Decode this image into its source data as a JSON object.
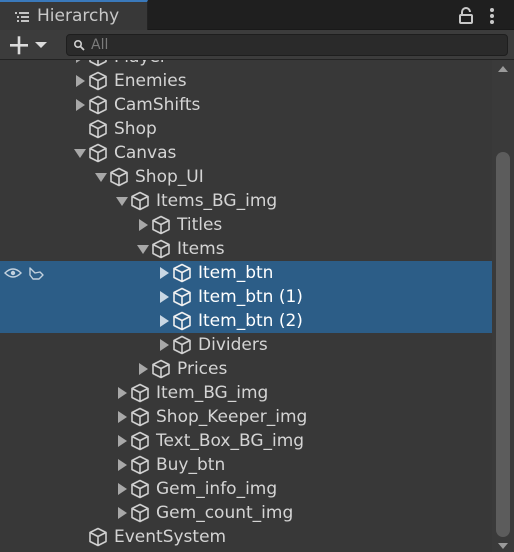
{
  "panel": {
    "title": "Hierarchy",
    "lock_icon": "lock-icon",
    "more_icon": "more-vertical-icon"
  },
  "toolbar": {
    "create_icon": "plus-icon",
    "search_placeholder": "All",
    "search_value": ""
  },
  "tree": {
    "items": [
      {
        "label": "Player",
        "depth": 1,
        "expander": "collapsed",
        "selected": false
      },
      {
        "label": "Enemies",
        "depth": 1,
        "expander": "collapsed",
        "selected": false
      },
      {
        "label": "CamShifts",
        "depth": 1,
        "expander": "collapsed",
        "selected": false
      },
      {
        "label": "Shop",
        "depth": 1,
        "expander": "none",
        "selected": false
      },
      {
        "label": "Canvas",
        "depth": 1,
        "expander": "expanded",
        "selected": false
      },
      {
        "label": "Shop_UI",
        "depth": 2,
        "expander": "expanded",
        "selected": false
      },
      {
        "label": "Items_BG_img",
        "depth": 3,
        "expander": "expanded",
        "selected": false
      },
      {
        "label": "Titles",
        "depth": 4,
        "expander": "collapsed",
        "selected": false
      },
      {
        "label": "Items",
        "depth": 4,
        "expander": "expanded",
        "selected": false
      },
      {
        "label": "Item_btn",
        "depth": 5,
        "expander": "collapsed",
        "selected": true
      },
      {
        "label": "Item_btn (1)",
        "depth": 5,
        "expander": "collapsed",
        "selected": true
      },
      {
        "label": "Item_btn (2)",
        "depth": 5,
        "expander": "collapsed",
        "selected": true
      },
      {
        "label": "Dividers",
        "depth": 5,
        "expander": "collapsed",
        "selected": false
      },
      {
        "label": "Prices",
        "depth": 4,
        "expander": "collapsed",
        "selected": false
      },
      {
        "label": "Item_BG_img",
        "depth": 3,
        "expander": "collapsed",
        "selected": false
      },
      {
        "label": "Shop_Keeper_img",
        "depth": 3,
        "expander": "collapsed",
        "selected": false
      },
      {
        "label": "Text_Box_BG_img",
        "depth": 3,
        "expander": "collapsed",
        "selected": false
      },
      {
        "label": "Buy_btn",
        "depth": 3,
        "expander": "collapsed",
        "selected": false
      },
      {
        "label": "Gem_info_img",
        "depth": 3,
        "expander": "collapsed",
        "selected": false
      },
      {
        "label": "Gem_count_img",
        "depth": 3,
        "expander": "collapsed",
        "selected": false
      },
      {
        "label": "EventSystem",
        "depth": 1,
        "expander": "none",
        "selected": false
      }
    ]
  },
  "colors": {
    "selection": "#2c5d87",
    "tab_accent": "#3a79bb",
    "background": "#383838"
  }
}
